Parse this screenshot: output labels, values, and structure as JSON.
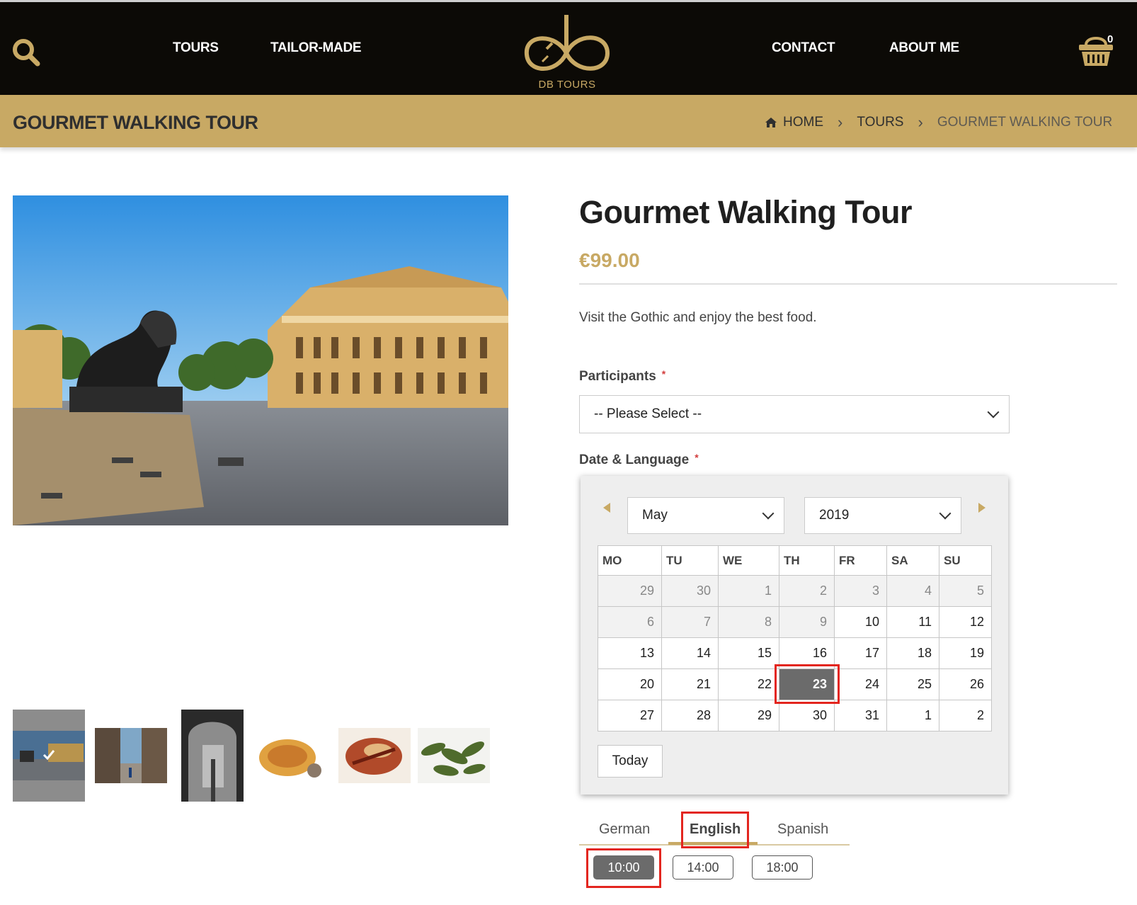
{
  "header": {
    "nav": [
      "TOURS",
      "TAILOR-MADE",
      "CONTACT",
      "ABOUT ME"
    ],
    "logo_text": "DB TOURS",
    "cart_count": "0",
    "icons": {
      "search": "search-icon",
      "cart": "basket-icon",
      "home": "home-icon"
    }
  },
  "title_band": {
    "title": "GOURMET WALKING TOUR",
    "breadcrumb": [
      "HOME",
      "TOURS",
      "GOURMET WALKING TOUR"
    ]
  },
  "product": {
    "title": "Gourmet Walking Tour",
    "price": "€99.00",
    "description": "Visit the Gothic and enjoy the best food.",
    "participants": {
      "label": "Participants",
      "required_mark": "*",
      "value": "-- Please Select --"
    },
    "date_language": {
      "label": "Date & Language",
      "required_mark": "*"
    }
  },
  "calendar": {
    "month": "May",
    "year": "2019",
    "weekdays": [
      "MO",
      "TU",
      "WE",
      "TH",
      "FR",
      "SA",
      "SU"
    ],
    "weeks": [
      [
        "29",
        "30",
        "1",
        "2",
        "3",
        "4",
        "5"
      ],
      [
        "6",
        "7",
        "8",
        "9",
        "10",
        "11",
        "12"
      ],
      [
        "13",
        "14",
        "15",
        "16",
        "17",
        "18",
        "19"
      ],
      [
        "20",
        "21",
        "22",
        "23",
        "24",
        "25",
        "26"
      ],
      [
        "27",
        "28",
        "29",
        "30",
        "31",
        "1",
        "2"
      ]
    ],
    "selected_day": "23",
    "today_label": "Today"
  },
  "languages": {
    "tabs": [
      "German",
      "English",
      "Spanish"
    ],
    "active": "English"
  },
  "time_slots": {
    "slots": [
      "10:00",
      "14:00",
      "18:00"
    ],
    "selected": "10:00"
  },
  "colors": {
    "header_bg": "#0c0a06",
    "gold": "#c8a964",
    "selected_grey": "#6b6b6b",
    "highlight_red": "#e3261f"
  }
}
